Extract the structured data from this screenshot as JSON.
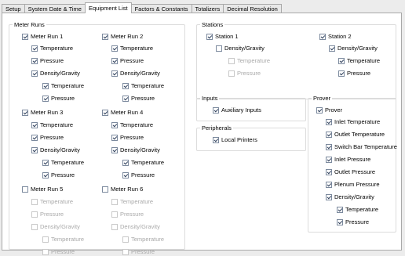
{
  "tabs": [
    "Setup",
    "System Date & Time",
    "Equipment List",
    "Factors & Constants",
    "Totalizers",
    "Decimal Resolution"
  ],
  "groups": {
    "meter_runs": "Meter Runs",
    "stations": "Stations",
    "inputs": "Inputs",
    "peripherals": "Peripherals",
    "prover": "Prover"
  },
  "meter_run_1": {
    "label": "Meter Run 1",
    "temperature": "Temperature",
    "pressure": "Pressure",
    "density": "Density/Gravity",
    "d_temperature": "Temperature",
    "d_pressure": "Pressure"
  },
  "meter_run_2": {
    "label": "Meter Run 2",
    "temperature": "Temperature",
    "pressure": "Pressure",
    "density": "Density/Gravity",
    "d_temperature": "Temperature",
    "d_pressure": "Pressure"
  },
  "meter_run_3": {
    "label": "Meter Run 3",
    "temperature": "Temperature",
    "pressure": "Pressure",
    "density": "Density/Gravity",
    "d_temperature": "Temperature",
    "d_pressure": "Pressure"
  },
  "meter_run_4": {
    "label": "Meter Run 4",
    "temperature": "Temperature",
    "pressure": "Pressure",
    "density": "Density/Gravity",
    "d_temperature": "Temperature",
    "d_pressure": "Pressure"
  },
  "meter_run_5": {
    "label": "Meter Run 5",
    "temperature": "Temperature",
    "pressure": "Pressure",
    "density": "Density/Gravity",
    "d_temperature": "Temperature",
    "d_pressure": "Pressure"
  },
  "meter_run_6": {
    "label": "Meter Run 6",
    "temperature": "Temperature",
    "pressure": "Pressure",
    "density": "Density/Gravity",
    "d_temperature": "Temperature",
    "d_pressure": "Pressure"
  },
  "station_1": {
    "label": "Station 1",
    "density": "Density/Gravity",
    "d_temperature": "Temperature",
    "d_pressure": "Pressure"
  },
  "station_2": {
    "label": "Station 2",
    "density": "Density/Gravity",
    "d_temperature": "Temperature",
    "d_pressure": "Pressure"
  },
  "inputs": {
    "auxiliary": "Auxiliary Inputs"
  },
  "peripherals": {
    "local_printers": "Local Printers"
  },
  "prover": {
    "label": "Prover",
    "inlet_temperature": "Inlet Temperature",
    "outlet_temperature": "Outlet Temperature",
    "switch_bar_temperature": "Switch Bar Temperature",
    "inlet_pressure": "Inlet Pressure",
    "outlet_pressure": "Outlet Pressure",
    "plenum_pressure": "Plenum Pressure",
    "density": "Density/Gravity",
    "d_temperature": "Temperature",
    "d_pressure": "Pressure"
  }
}
